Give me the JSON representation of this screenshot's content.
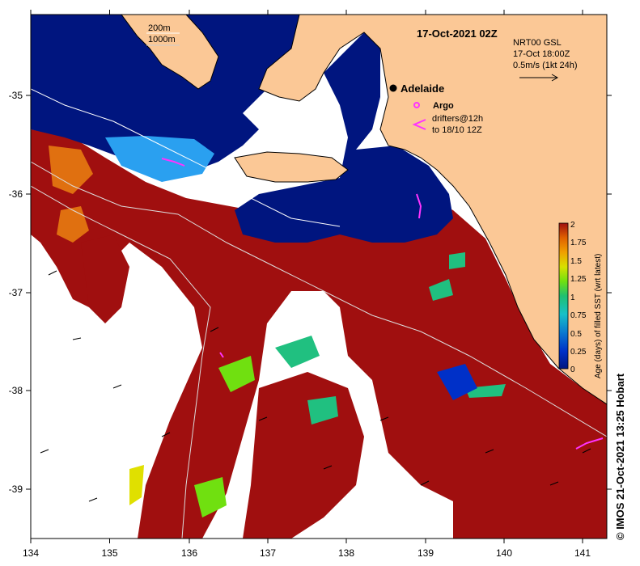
{
  "map": {
    "title": "17-Oct-2021 02Z",
    "contour_labels": [
      "200m",
      "1000m"
    ],
    "current_info": [
      "NRT00 GSL",
      "17-Oct 18:00Z",
      "0.5m/s (1kt 24h)"
    ],
    "city": "Adelaide",
    "argo_label": "Argo",
    "drifters_label": [
      "drifters@12h",
      "to 18/10 12Z"
    ],
    "colorbar_label": "Age (days) of filled SST (wrt latest)",
    "colorbar_ticks": [
      "2",
      "1.75",
      "1.5",
      "1.25",
      "1",
      "0.75",
      "0.5",
      "0.25",
      "0"
    ],
    "lon_ticks": [
      "134",
      "135",
      "136",
      "137",
      "138",
      "139",
      "140",
      "141"
    ],
    "lat_ticks": [
      "-35",
      "-36",
      "-37",
      "-38",
      "-39"
    ],
    "credit": "© IMOS 21-Oct-2021 13:25 Hobart"
  },
  "colors": {
    "land": "#fbc896",
    "fresh": "#00157f",
    "old": "#a00f0f",
    "argo": "#ff33ff",
    "coast": "#000000"
  }
}
